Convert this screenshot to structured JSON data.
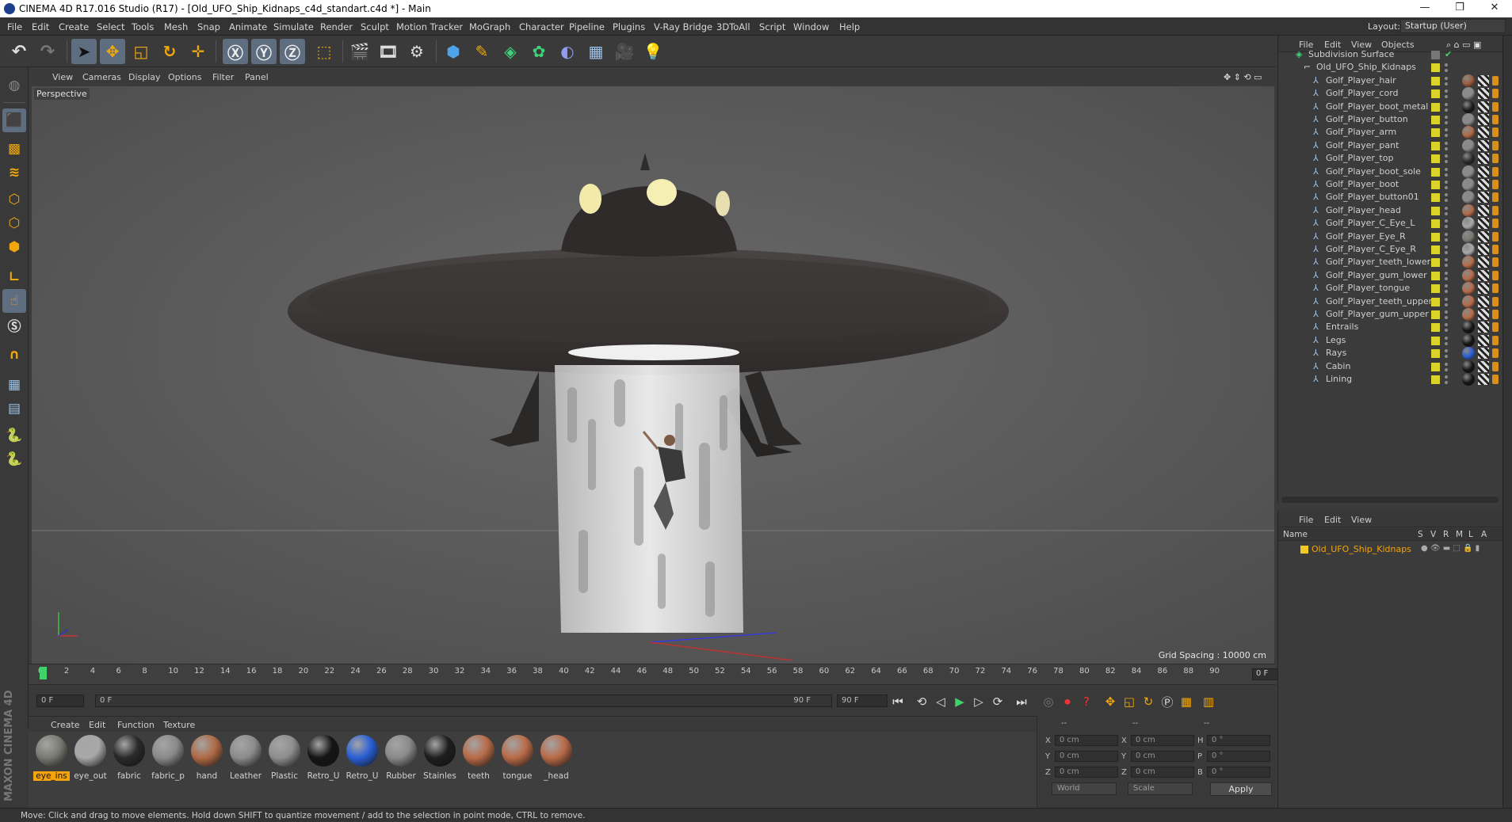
{
  "window": {
    "title": "CINEMA 4D R17.016 Studio (R17) - [Old_UFO_Ship_Kidnaps_c4d_standart.c4d *] - Main",
    "controls": [
      "—",
      "❐",
      "✕"
    ]
  },
  "menubar": {
    "items": [
      "File",
      "Edit",
      "Create",
      "Select",
      "Tools",
      "Mesh",
      "Snap",
      "Animate",
      "Simulate",
      "Render",
      "Sculpt",
      "Motion Tracker",
      "MoGraph",
      "Character",
      "Pipeline",
      "Plugins",
      "V-Ray Bridge",
      "3DToAll",
      "Script",
      "Window",
      "Help"
    ],
    "layout_label": "Layout:",
    "layout_value": "Startup (User)"
  },
  "viewport": {
    "menu": [
      "View",
      "Cameras",
      "Display",
      "Options",
      "Filter",
      "Panel"
    ],
    "camera_label": "Perspective",
    "grid_spacing": "Grid Spacing : 10000 cm"
  },
  "timeline": {
    "ticks": [
      "0",
      "2",
      "4",
      "6",
      "8",
      "10",
      "12",
      "14",
      "16",
      "18",
      "20",
      "22",
      "24",
      "26",
      "28",
      "30",
      "32",
      "34",
      "36",
      "38",
      "40",
      "42",
      "44",
      "46",
      "48",
      "50",
      "52",
      "54",
      "56",
      "58",
      "60",
      "62",
      "64",
      "66",
      "68",
      "70",
      "72",
      "74",
      "76",
      "78",
      "80",
      "82",
      "84",
      "86",
      "88",
      "90"
    ],
    "current_frame": "0 F",
    "start_field": "0 F",
    "range_start": "0 F",
    "range_end": "90 F",
    "end_field": "90 F"
  },
  "material_manager": {
    "menu": [
      "Create",
      "Edit",
      "Function",
      "Texture"
    ],
    "materials": [
      {
        "name": "eye_ins",
        "color": "#7a7a72",
        "selected": true
      },
      {
        "name": "eye_out",
        "color": "#a8a8a8",
        "selected": false
      },
      {
        "name": "fabric",
        "color": "#2a2a2a",
        "selected": false
      },
      {
        "name": "fabric_p",
        "color": "#8a8a8a",
        "selected": false
      },
      {
        "name": "hand",
        "color": "#b06a45",
        "selected": false
      },
      {
        "name": "Leather",
        "color": "#8c8c8c",
        "selected": false
      },
      {
        "name": "Plastic",
        "color": "#8e8e8e",
        "selected": false
      },
      {
        "name": "Retro_U",
        "color": "#151515",
        "selected": false
      },
      {
        "name": "Retro_U",
        "color": "#2a5fd6",
        "selected": false
      },
      {
        "name": "Rubber",
        "color": "#8a8a8a",
        "selected": false
      },
      {
        "name": "Stainles",
        "color": "#1e1e1e",
        "selected": false
      },
      {
        "name": "teeth",
        "color": "#b86b48",
        "selected": false
      },
      {
        "name": "tongue",
        "color": "#b86b48",
        "selected": false
      },
      {
        "name": "_head",
        "color": "#b86b48",
        "selected": false
      }
    ]
  },
  "coordinates": {
    "header": [
      "--",
      "--",
      "--"
    ],
    "rows": [
      {
        "a": "X",
        "av": "0 cm",
        "b": "X",
        "bv": "0 cm",
        "c": "H",
        "cv": "0 °"
      },
      {
        "a": "Y",
        "av": "0 cm",
        "b": "Y",
        "bv": "0 cm",
        "c": "P",
        "cv": "0 °"
      },
      {
        "a": "Z",
        "av": "0 cm",
        "b": "Z",
        "bv": "0 cm",
        "c": "B",
        "cv": "0 °"
      }
    ],
    "mode": "World",
    "transform": "Scale",
    "apply": "Apply"
  },
  "object_manager": {
    "menu": [
      "File",
      "Edit",
      "View",
      "Objects"
    ],
    "objects": [
      {
        "name": "Subdivision Surface",
        "level": 0,
        "mat": ""
      },
      {
        "name": "Old_UFO_Ship_Kidnaps",
        "level": 1,
        "mat": ""
      },
      {
        "name": "Golf_Player_hair",
        "level": 2,
        "mat": "#9a5a3a"
      },
      {
        "name": "Golf_Player_cord",
        "level": 2,
        "mat": "#8a8a8a"
      },
      {
        "name": "Golf_Player_boot_metal",
        "level": 2,
        "mat": "#1c1c1c"
      },
      {
        "name": "Golf_Player_button",
        "level": 2,
        "mat": "#8a8a8a"
      },
      {
        "name": "Golf_Player_arm",
        "level": 2,
        "mat": "#b06a45"
      },
      {
        "name": "Golf_Player_pant",
        "level": 2,
        "mat": "#8a8a8a"
      },
      {
        "name": "Golf_Player_top",
        "level": 2,
        "mat": "#2a2a2a"
      },
      {
        "name": "Golf_Player_boot_sole",
        "level": 2,
        "mat": "#8a8a8a"
      },
      {
        "name": "Golf_Player_boot",
        "level": 2,
        "mat": "#8a8a8a"
      },
      {
        "name": "Golf_Player_button01",
        "level": 2,
        "mat": "#8a8a8a"
      },
      {
        "name": "Golf_Player_head",
        "level": 2,
        "mat": "#b06a45"
      },
      {
        "name": "Golf_Player_C_Eye_L",
        "level": 2,
        "mat": "#a8a8a8"
      },
      {
        "name": "Golf_Player_Eye_R",
        "level": 2,
        "mat": "#7a7a72"
      },
      {
        "name": "Golf_Player_C_Eye_R",
        "level": 2,
        "mat": "#a8a8a8"
      },
      {
        "name": "Golf_Player_teeth_lower",
        "level": 2,
        "mat": "#b86b48"
      },
      {
        "name": "Golf_Player_gum_lower",
        "level": 2,
        "mat": "#b86b48"
      },
      {
        "name": "Golf_Player_tongue",
        "level": 2,
        "mat": "#b86b48"
      },
      {
        "name": "Golf_Player_teeth_upper",
        "level": 2,
        "mat": "#b86b48"
      },
      {
        "name": "Golf_Player_gum_upper",
        "level": 2,
        "mat": "#b86b48"
      },
      {
        "name": "Entrails",
        "level": 2,
        "mat": "#151515"
      },
      {
        "name": "Legs",
        "level": 2,
        "mat": "#151515"
      },
      {
        "name": "Rays",
        "level": 2,
        "mat": "#2a5fd6"
      },
      {
        "name": "Cabin",
        "level": 2,
        "mat": "#151515"
      },
      {
        "name": "Lining",
        "level": 2,
        "mat": "#151515"
      }
    ]
  },
  "layer_manager": {
    "menu": [
      "File",
      "Edit",
      "View"
    ],
    "columns": [
      "Name",
      "S",
      "V",
      "R",
      "M",
      "L",
      "A"
    ],
    "row": "Old_UFO_Ship_Kidnaps"
  },
  "status": {
    "text": "Move: Click and drag to move elements. Hold down SHIFT to quantize movement / add to the selection in point mode, CTRL to remove."
  },
  "branding": "MAXON CINEMA 4D",
  "colors": {
    "accent": "#f4a30a",
    "selection": "#5f6d80",
    "viewport_bg": "#5b5b5b"
  }
}
